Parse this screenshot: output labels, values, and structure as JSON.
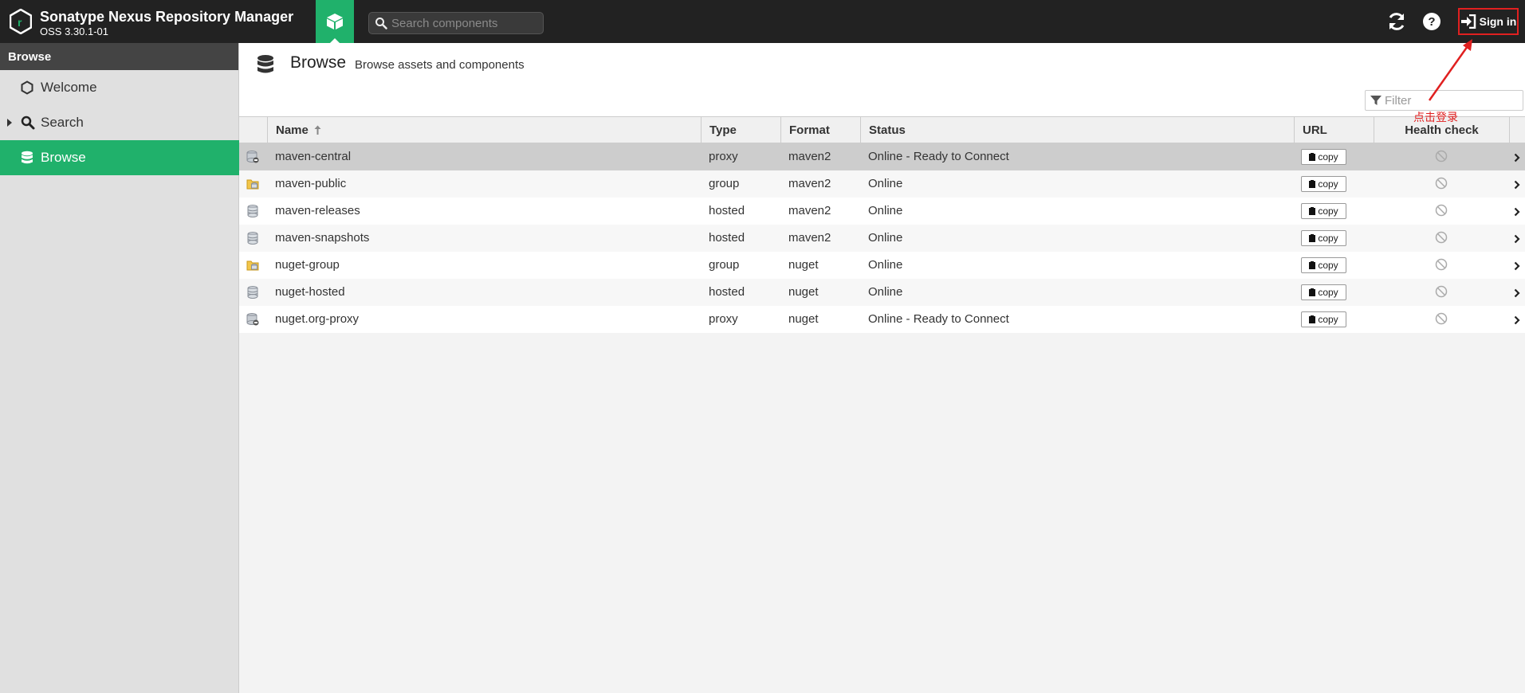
{
  "header": {
    "app_title": "Sonatype Nexus Repository Manager",
    "app_version": "OSS 3.30.1-01",
    "search_placeholder": "Search components",
    "sign_in_label": "Sign in"
  },
  "sidebar": {
    "section_title": "Browse",
    "items": [
      {
        "label": "Welcome",
        "icon": "hexagon-icon"
      },
      {
        "label": "Search",
        "icon": "search-icon"
      },
      {
        "label": "Browse",
        "icon": "database-icon",
        "active": true
      }
    ]
  },
  "main": {
    "title": "Browse",
    "subtitle": "Browse assets and components",
    "filter_placeholder": "Filter"
  },
  "annotation": {
    "text": "点击登录"
  },
  "table": {
    "columns": [
      "Name",
      "Type",
      "Format",
      "Status",
      "URL",
      "Health check"
    ],
    "sort_column": "Name",
    "rows": [
      {
        "name": "maven-central",
        "type": "proxy",
        "format": "maven2",
        "status": "Online - Ready to Connect",
        "url_button": "copy",
        "icon": "proxy-repo-icon"
      },
      {
        "name": "maven-public",
        "type": "group",
        "format": "maven2",
        "status": "Online",
        "url_button": "copy",
        "icon": "group-repo-icon"
      },
      {
        "name": "maven-releases",
        "type": "hosted",
        "format": "maven2",
        "status": "Online",
        "url_button": "copy",
        "icon": "hosted-repo-icon"
      },
      {
        "name": "maven-snapshots",
        "type": "hosted",
        "format": "maven2",
        "status": "Online",
        "url_button": "copy",
        "icon": "hosted-repo-icon"
      },
      {
        "name": "nuget-group",
        "type": "group",
        "format": "nuget",
        "status": "Online",
        "url_button": "copy",
        "icon": "group-repo-icon"
      },
      {
        "name": "nuget-hosted",
        "type": "hosted",
        "format": "nuget",
        "status": "Online",
        "url_button": "copy",
        "icon": "hosted-repo-icon"
      },
      {
        "name": "nuget.org-proxy",
        "type": "proxy",
        "format": "nuget",
        "status": "Online - Ready to Connect",
        "url_button": "copy",
        "icon": "proxy-repo-icon"
      }
    ]
  },
  "colors": {
    "accent": "#20b16b",
    "header_bg": "#222222",
    "annotation": "#e02020"
  }
}
